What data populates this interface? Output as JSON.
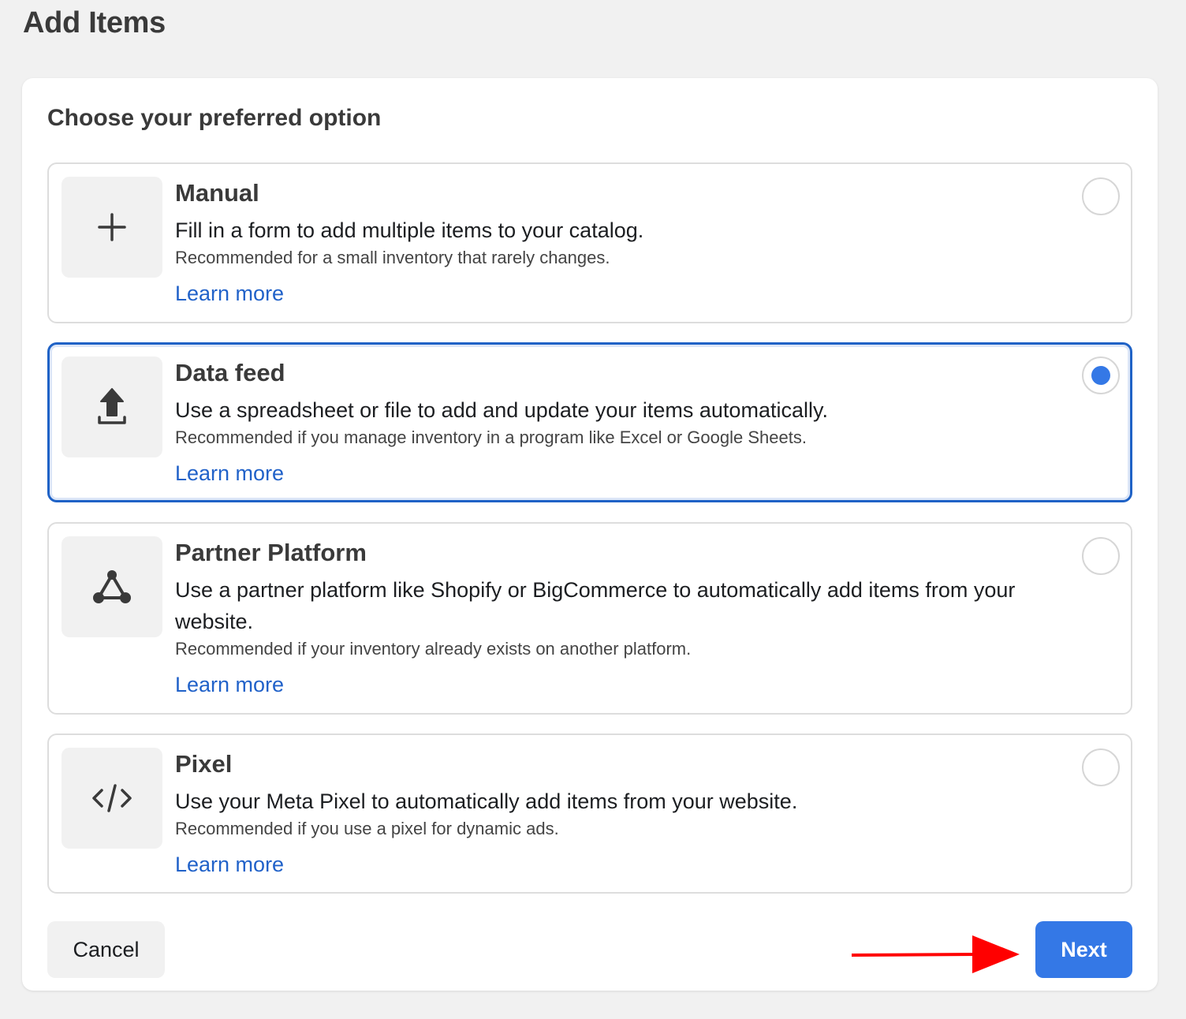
{
  "page": {
    "title": "Add Items"
  },
  "card": {
    "heading": "Choose your preferred option"
  },
  "options": [
    {
      "id": "manual",
      "icon": "plus-icon",
      "title": "Manual",
      "description": "Fill in a form to add multiple items to your catalog.",
      "recommendation": "Recommended for a small inventory that rarely changes.",
      "link": "Learn more",
      "selected": false
    },
    {
      "id": "data-feed",
      "icon": "upload-icon",
      "title": "Data feed",
      "description": "Use a spreadsheet or file to add and update your items automatically.",
      "recommendation": "Recommended if you manage inventory in a program like Excel or Google Sheets.",
      "link": "Learn more",
      "selected": true
    },
    {
      "id": "partner-platform",
      "icon": "network-triangle-icon",
      "title": "Partner Platform",
      "description": "Use a partner platform like Shopify or BigCommerce to automatically add items from your website.",
      "recommendation": "Recommended if your inventory already exists on another platform.",
      "link": "Learn more",
      "selected": false
    },
    {
      "id": "pixel",
      "icon": "code-icon",
      "title": "Pixel",
      "description": "Use your Meta Pixel to automatically add items from your website.",
      "recommendation": "Recommended if you use a pixel for dynamic ads.",
      "link": "Learn more",
      "selected": false
    }
  ],
  "footer": {
    "cancel_label": "Cancel",
    "next_label": "Next"
  },
  "colors": {
    "accent": "#3478e6",
    "selected_border": "#1f62c6",
    "link": "#2162c9",
    "annotation": "#ff0000"
  }
}
